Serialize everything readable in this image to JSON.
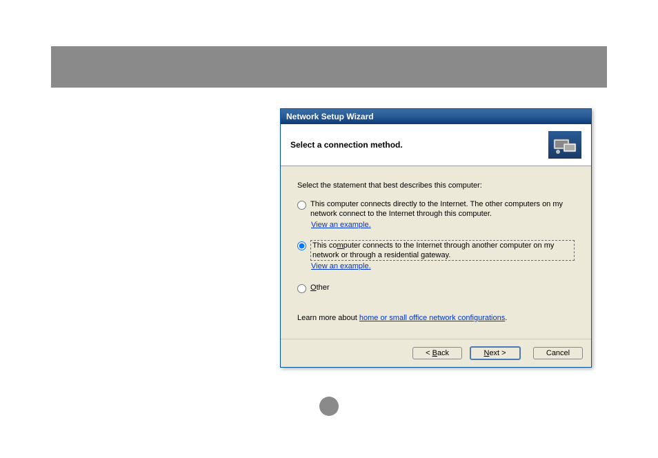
{
  "wizard": {
    "title": "Network Setup Wizard",
    "header": "Select a connection method.",
    "instruction": "Select the statement that best describes this computer:",
    "options": {
      "direct": {
        "text_prefix": "This computer connects directly to the Internet. The other computers on my network connect to the Internet through this computer.",
        "example": "View an example"
      },
      "gateway": {
        "text_prefix": "This co",
        "access_letter": "m",
        "text_suffix": "puter connects to the Internet through another computer on my network or through a residential gateway.",
        "example": "View an example"
      },
      "other": {
        "access_letter": "O",
        "text": "ther"
      }
    },
    "learn_more_prefix": "Learn more about ",
    "learn_more_link": "home or small office network configurations",
    "buttons": {
      "back_prefix": "< ",
      "back_access": "B",
      "back_suffix": "ack",
      "next_access": "N",
      "next_suffix": "ext >",
      "cancel": "Cancel"
    }
  }
}
